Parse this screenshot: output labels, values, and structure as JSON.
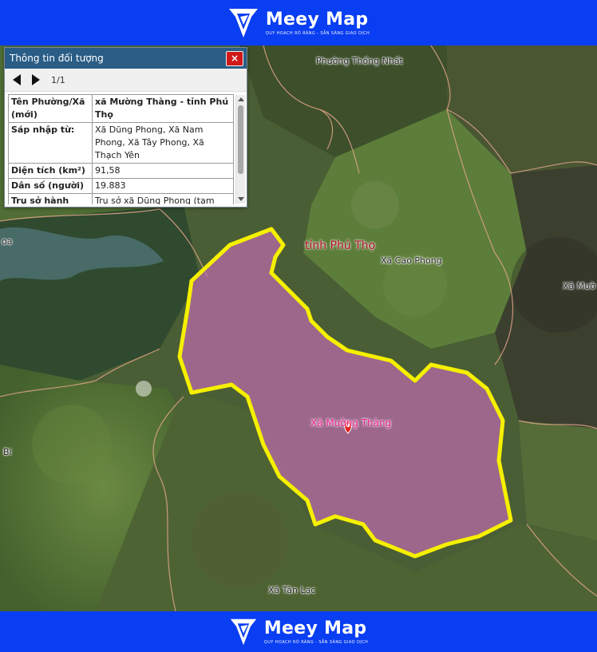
{
  "brand": {
    "name": "Meey Map",
    "tagline": "QUY HOẠCH RÕ RÀNG - SẴN SÀNG GIAO DỊCH",
    "color": "#0a3ef2"
  },
  "panel": {
    "title": "Thông tin đối tượng",
    "close_label": "×",
    "pager": "1/1",
    "rows": [
      {
        "key": "Tên Phường/Xã (mới)",
        "value": "xã Mường Thàng - tỉnh Phú Thọ"
      },
      {
        "key": "Sáp nhập từ:",
        "value": "Xã Dũng Phong, Xã Nam Phong, Xã Tây Phong, Xã Thạch Yên"
      },
      {
        "key": "Diện tích (km²)",
        "value": "91,58"
      },
      {
        "key": "Dân số (người)",
        "value": "19.883"
      },
      {
        "key": "Trụ sở hành chính (mới)",
        "value": "Trụ sở xã Dũng Phong (tạm thời sử dụng trụ sở xã Nam Phong)"
      }
    ]
  },
  "map": {
    "labels": {
      "phuong_thong_nhat": "Phường Thống Nhất",
      "tinh_phu_tho": "tỉnh Phú Thọ",
      "xa_cao_phong": "Xã Cao Phong",
      "xa_muong_right": "Xã Mườ",
      "xa_muong_thang": "Xã Mường Thàng",
      "xa_tan_lac": "Xã Tân Lạc",
      "left_bi": "Bi",
      "left_oa": "oa"
    },
    "selected_region_color": "#c06bb0",
    "boundary_color": "#f5f000"
  },
  "icons": {
    "logo": "meey-logo-icon",
    "marker": "map-pin-icon",
    "close": "close-icon",
    "prev": "arrow-left-icon",
    "next": "arrow-right-icon"
  }
}
